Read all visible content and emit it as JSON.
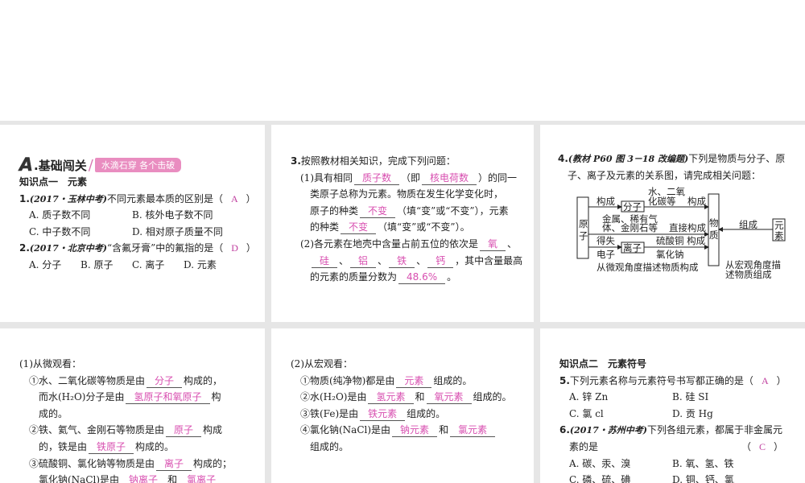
{
  "panel1": {
    "header": {
      "letter": "A",
      "title": ".基础闯关",
      "slogan": "水滴石穿 各个击破"
    },
    "lines": [
      {
        "segs": [
          {
            "t": "知识点一　元素",
            "s": "bold"
          }
        ]
      },
      {
        "segs": [
          {
            "t": "1.",
            "s": "bold"
          },
          {
            "t": "(2017・玉林中考)",
            "s": "src"
          },
          {
            "t": "不同元素最本质的区别是（"
          },
          {
            "c": "A"
          },
          {
            "t": "）"
          }
        ]
      },
      {
        "opts": [
          "A. 质子数不同",
          "B. 核外电子数不同"
        ]
      },
      {
        "opts": [
          "C. 中子数不同",
          "D. 相对原子质量不同"
        ]
      },
      {
        "segs": [
          {
            "t": "2.",
            "s": "bold"
          },
          {
            "t": "(2017・北京中考)",
            "s": "src"
          },
          {
            "t": "“含氟牙膏”中的氟指的是（"
          },
          {
            "c": "D"
          },
          {
            "t": "）"
          }
        ]
      },
      {
        "quad": [
          "A. 分子",
          "B. 原子",
          "C. 离子",
          "D. 元素"
        ]
      }
    ]
  },
  "panel2": {
    "lines": [
      {
        "segs": [
          {
            "t": "3.",
            "s": "bold"
          },
          {
            "t": "按照教材相关知识，完成下列问题："
          }
        ]
      },
      {
        "ind": 1,
        "segs": [
          {
            "t": "(1)具有相同"
          },
          {
            "a": "质子数"
          },
          {
            "t": "（即"
          },
          {
            "a": "核电荷数"
          },
          {
            "t": "）的同一"
          }
        ]
      },
      {
        "ind": 2,
        "segs": [
          {
            "t": "类原子总称为元素。物质在发生化学变化时，"
          }
        ]
      },
      {
        "ind": 2,
        "segs": [
          {
            "t": "原子的种类"
          },
          {
            "a": "不变"
          },
          {
            "t": "（填“变”或“不变”），元素"
          }
        ]
      },
      {
        "ind": 2,
        "segs": [
          {
            "t": "的种类"
          },
          {
            "a": "不变"
          },
          {
            "t": "（填“变”或“不变”）。"
          }
        ]
      },
      {
        "ind": 1,
        "segs": [
          {
            "t": "(2)各元素在地壳中含量占前五位的依次是"
          },
          {
            "a": "氧"
          },
          {
            "t": "、"
          }
        ]
      },
      {
        "ind": 2,
        "segs": [
          {
            "a": "硅"
          },
          {
            "t": "、"
          },
          {
            "a": "铝"
          },
          {
            "t": "、"
          },
          {
            "a": "铁"
          },
          {
            "t": "、"
          },
          {
            "a": "钙"
          },
          {
            "t": "，其中含量最高"
          }
        ]
      },
      {
        "ind": 2,
        "segs": [
          {
            "t": "的元素的质量分数为"
          },
          {
            "a": "48.6%"
          },
          {
            "t": "。"
          }
        ]
      }
    ]
  },
  "panel3": {
    "lines": [
      {
        "segs": [
          {
            "t": "4.",
            "s": "bold"
          },
          {
            "t": "(教材 P60 图 3－18 改编题)",
            "s": "src"
          },
          {
            "t": "下列是物质与分子、原"
          }
        ]
      },
      {
        "ind": 1,
        "segs": [
          {
            "t": "子、离子及元素的关系图，请完成相关问题："
          }
        ]
      }
    ],
    "diagram": {
      "atom": [
        "原",
        "子"
      ],
      "molecule": "分子",
      "ion": "离子",
      "substance": [
        "物",
        "质"
      ],
      "element": [
        "元",
        "素"
      ],
      "compose1": "构成",
      "water1": "水、二氧",
      "water2": "化碳等",
      "compose2": "构成",
      "metal1": "金属、稀有气",
      "metal2": "体、金刚石等",
      "direct": "直接构成",
      "gain1": "得失",
      "gain2": "电子",
      "cuso4": "硫酸铜  构成",
      "nacl": "氯化钠",
      "micro": "从微观角度描述物质构成",
      "consist": "组成",
      "macro1": "从宏观角度描",
      "macro2": "述物质组成"
    }
  },
  "panel4": {
    "lines": [
      {
        "segs": [
          {
            "t": "(1)从微观看："
          }
        ]
      },
      {
        "ind": 1,
        "segs": [
          {
            "t": "①水、二氧化碳等物质是由"
          },
          {
            "a": "分子"
          },
          {
            "t": "构成的，"
          }
        ]
      },
      {
        "ind": 2,
        "segs": [
          {
            "t": "而水(H₂O)分子是由"
          },
          {
            "a": "氢原子和氧原子"
          },
          {
            "t": "构"
          }
        ]
      },
      {
        "ind": 2,
        "segs": [
          {
            "t": "成的。"
          }
        ]
      },
      {
        "ind": 1,
        "segs": [
          {
            "t": "②铁、氦气、金刚石等物质是由"
          },
          {
            "a": "原子"
          },
          {
            "t": "构成"
          }
        ]
      },
      {
        "ind": 2,
        "segs": [
          {
            "t": "的，铁是由"
          },
          {
            "a": "铁原子"
          },
          {
            "t": "构成的。"
          }
        ]
      },
      {
        "ind": 1,
        "segs": [
          {
            "t": "③硫酸铜、氯化钠等物质是由"
          },
          {
            "a": "离子"
          },
          {
            "t": "构成的；"
          }
        ]
      },
      {
        "ind": 2,
        "segs": [
          {
            "t": "氯化钠(NaCl)是由"
          },
          {
            "a": "钠离子"
          },
          {
            "t": "和"
          },
          {
            "a": "氯离子"
          }
        ]
      }
    ]
  },
  "panel5": {
    "lines": [
      {
        "segs": [
          {
            "t": "(2)从宏观看："
          }
        ]
      },
      {
        "ind": 1,
        "segs": [
          {
            "t": "①物质(纯净物)都是由"
          },
          {
            "a": "元素"
          },
          {
            "t": "组成的。"
          }
        ]
      },
      {
        "ind": 1,
        "segs": [
          {
            "t": "②水(H₂O)是由"
          },
          {
            "a": "氢元素"
          },
          {
            "t": "和"
          },
          {
            "a": "氧元素"
          },
          {
            "t": "组成的。"
          }
        ]
      },
      {
        "ind": 1,
        "segs": [
          {
            "t": "③铁(Fe)是由"
          },
          {
            "a": "铁元素"
          },
          {
            "t": "组成的。"
          }
        ]
      },
      {
        "ind": 1,
        "segs": [
          {
            "t": "④氯化钠(NaCl)是由"
          },
          {
            "a": "钠元素"
          },
          {
            "t": "和"
          },
          {
            "a": "氯元素"
          }
        ]
      },
      {
        "ind": 2,
        "segs": [
          {
            "t": "组成的。"
          }
        ]
      }
    ]
  },
  "panel6": {
    "lines": [
      {
        "segs": [
          {
            "t": "知识点二　元素符号",
            "s": "bold"
          }
        ]
      },
      {
        "segs": [
          {
            "t": "5.",
            "s": "bold"
          },
          {
            "t": "下列元素名称与元素符号书写都正确的是（"
          },
          {
            "c": "A"
          },
          {
            "t": "）"
          }
        ]
      },
      {
        "opts": [
          "A. 锌 Zn",
          "B. 硅 SI"
        ]
      },
      {
        "opts": [
          "C. 氯 cl",
          "D. 贡 Hg"
        ]
      },
      {
        "segs": [
          {
            "t": "6.",
            "s": "bold"
          },
          {
            "t": "(2017・苏州中考)",
            "s": "src"
          },
          {
            "t": "下列各组元素，都属于非金属元"
          }
        ]
      },
      {
        "ind": 1,
        "right": true,
        "segs": [
          {
            "t": "素的是"
          },
          {
            "t": "（"
          },
          {
            "c": "C"
          },
          {
            "t": "）"
          }
        ]
      },
      {
        "opts": [
          "A. 碳、汞、溴",
          "B. 氧、氢、铁"
        ]
      },
      {
        "opts": [
          "C. 磷、硫、碘",
          "D. 铜、钙、氯"
        ]
      }
    ]
  }
}
